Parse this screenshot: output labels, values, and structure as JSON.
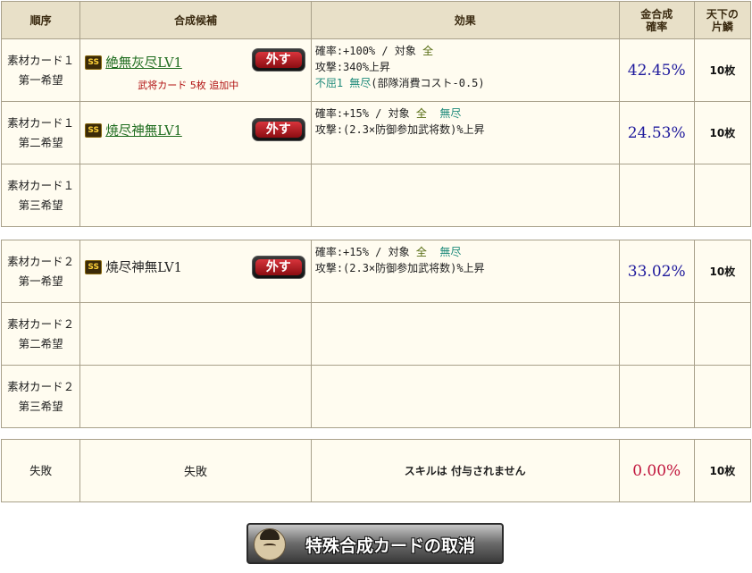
{
  "headers": {
    "order": "順序",
    "candidate": "合成候補",
    "effect": "効果",
    "rate": [
      "金合成",
      "確率"
    ],
    "scale": [
      "天下の",
      "片鱗"
    ]
  },
  "group1": [
    {
      "order": [
        "素材カード１",
        "第一希望"
      ],
      "rarity": "SS",
      "name": "絶無灰尽LV1",
      "sub": "武将カード 5枚 追加中",
      "remove_label": "外す",
      "effect": {
        "line1": {
          "a": "確率:+100%  /  対象 ",
          "b": "全"
        },
        "line2": "攻撃:340%上昇",
        "line3": {
          "a": "不屈1  無尽",
          "b": "(部隊消費コスト-0.5)"
        }
      },
      "rate": "42.45%",
      "scale": "10枚"
    },
    {
      "order": [
        "素材カード１",
        "第二希望"
      ],
      "rarity": "SS",
      "name": "焼尽神無LV1",
      "remove_label": "外す",
      "effect": {
        "line1": {
          "a": "確率:+15%  /  対象 ",
          "b": "全",
          "c": "無尽"
        },
        "line2": "攻撃:(2.3×防御参加武将数)%上昇"
      },
      "rate": "24.53%",
      "scale": "10枚"
    },
    {
      "order": [
        "素材カード１",
        "第三希望"
      ]
    }
  ],
  "group2": [
    {
      "order": [
        "素材カード２",
        "第一希望"
      ],
      "rarity": "SS",
      "name": "焼尽神無LV1",
      "remove_label": "外す",
      "effect": {
        "line1": {
          "a": "確率:+15%  /  対象 ",
          "b": "全",
          "c": "無尽"
        },
        "line2": "攻撃:(2.3×防御参加武将数)%上昇"
      },
      "rate": "33.02%",
      "scale": "10枚"
    },
    {
      "order": [
        "素材カード２",
        "第二希望"
      ]
    },
    {
      "order": [
        "素材カード２",
        "第三希望"
      ]
    }
  ],
  "failure": {
    "order": "失敗",
    "candidate": "失敗",
    "effect": "スキルは 付与されません",
    "rate": "0.00%",
    "scale": "10枚"
  },
  "cancel_button": "特殊合成カードの取消",
  "colors": {
    "rate": "#1f1a9c",
    "rate_fail": "#c0143c",
    "link": "#1d6b1d",
    "remove_btn": "#b51a20"
  }
}
